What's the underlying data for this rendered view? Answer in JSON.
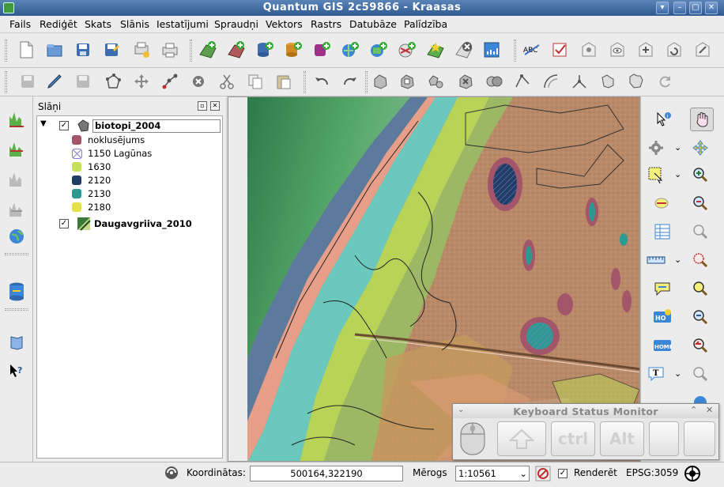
{
  "window": {
    "title": "Quantum GIS 2c59866 - Kraasas"
  },
  "menu": [
    "Fails",
    "Rediģēt",
    "Skats",
    "Slānis",
    "Iestatījumi",
    "Spraudņi",
    "Vektors",
    "Rastrs",
    "Datubāze",
    "Palīdzība"
  ],
  "panel": {
    "title": "Slāņi"
  },
  "layers": [
    {
      "name": "biotopi_2004",
      "checked": true,
      "expanded": true
    },
    {
      "name": "Daugavgriiva_2010",
      "checked": true
    }
  ],
  "legend": [
    {
      "label": "noklusējums",
      "color": "#a3556a"
    },
    {
      "label": "1150 Lagūnas",
      "color": "#8c7bd0"
    },
    {
      "label": "1630",
      "color": "#c6e05a"
    },
    {
      "label": "2120",
      "color": "#1f3e66"
    },
    {
      "label": "2130",
      "color": "#2d9a92"
    },
    {
      "label": "2180",
      "color": "#e6e04a"
    }
  ],
  "status": {
    "coord_label": "Koordinātas:",
    "coord_value": "500164,322190",
    "scale_label": "Mērogs",
    "scale_value": "1:10561",
    "render_label": "Renderēt",
    "epsg": "EPSG:3059"
  },
  "ksm": {
    "title": "Keyboard Status Monitor",
    "keys": [
      "ctrl",
      "Alt"
    ]
  }
}
